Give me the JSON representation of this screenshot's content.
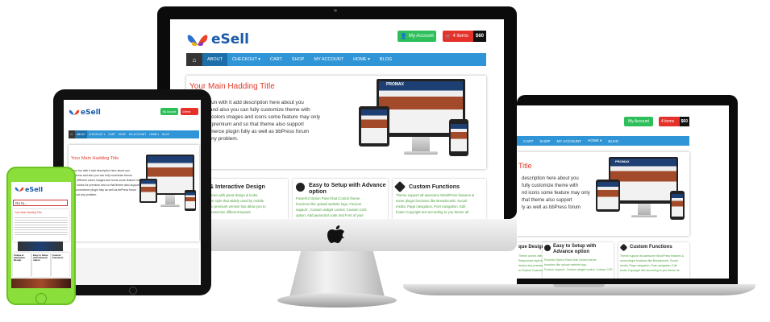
{
  "brand": {
    "logo_text": "eSell",
    "colors": {
      "blue": "#2f95d6",
      "green": "#2fbf5a",
      "red": "#e4322b",
      "title_red": "#e03a2a",
      "dark": "#353535"
    }
  },
  "header": {
    "account_label": "My Account",
    "cart_label": "4 items",
    "cart_price": "$60"
  },
  "nav": {
    "items": [
      "ABOUT",
      "CHECKOUT ▾",
      "CART",
      "SHOP",
      "MY ACCOUNT",
      "HOME ▾",
      "BLOG"
    ]
  },
  "hero": {
    "title": "Your Main Hadding Title",
    "lines_desktop": [
      "e fun with it add description here about you",
      "s and also you can fully customize theme with",
      "nt colors images and icons some feature may only",
      "or premium and so that theme also support",
      "mmerce plugin fully as well as bbPress forum",
      "t any problem."
    ],
    "lines_laptop": [
      "description here about you",
      "fully customize theme with",
      "nd icons some feature may only",
      "that theme also support",
      "ly as well as bbPress forum"
    ],
    "thumb_brand": "PROMAX"
  },
  "features": [
    {
      "title": "ique & Interactive Design",
      "lines": [
        "Theme comes with great design & looks.",
        "Responsive style that widely used by mobile",
        "device also premium version has allow you to",
        "Feature Customize different layouts"
      ]
    },
    {
      "title": "Easy to Setup with Advance option",
      "lines": [
        "Powerful Option Panel that Control theme",
        "functions like upload website logo, Favicon",
        "support , Custom widget control, Custom CSS",
        "option, Add javascript code and Font of your"
      ]
    },
    {
      "title": "Custom Functions",
      "lines": [
        "Theme support all awesome WordPress features &",
        "some plugin functions like Breadcrumb, Social",
        "media, Page navigation, Post navigation, Edit",
        "footer Copyright text according to you theme all"
      ]
    }
  ],
  "laptop": {
    "account_label": "My Account",
    "cart_label": "4 items",
    "cart_price": "$60",
    "nav_items": [
      "CART",
      "SHOP",
      "MY ACCOUNT",
      "HOME ▾",
      "BLOG"
    ],
    "hero_title": "Title",
    "features": [
      {
        "title": "que Design",
        "lines": [
          "Theme comes with great design & looks.",
          "Responsive style that widely used by mobile",
          "device also premium version has allow you",
          "to Feature Customize different layouts"
        ]
      },
      {
        "title": "Easy to Setup with Advance option",
        "lines": [
          "Powerful Option Panel that Control theme",
          "functions like upload website logo,",
          "Favicon support , Custom widget control, Custom CSS"
        ]
      },
      {
        "title": "Custom Functions",
        "lines": [
          "Theme support all awesome WordPress features &",
          "some plugin functions like Breadcrumb, Social",
          "media, Page navigation, Post navigation, Edit",
          "footer Copyright text according to you theme all"
        ]
      }
    ]
  },
  "tablet": {
    "logo_text": "eSell",
    "account_label": "My Account",
    "cart_label": "4 items",
    "nav_items": [
      "ABOUT",
      "CHECKOUT ▾",
      "CART",
      "SHOP",
      "MY ACCOUNT",
      "HOME ▾",
      "BLOG"
    ],
    "hero_title": "Your Main Hadding Title",
    "hero_lines": [
      "Have fun with it add description here about you",
      "business and also you can fully customize theme",
      "with different colors images and icons some feature may",
      "only works for premium and so that theme also support",
      "Woocommerce plugin fully as well as bbPress forum",
      "without any problem."
    ]
  },
  "phone": {
    "logo_text": "eSell",
    "menu_label": "Go to...",
    "hero_title": "Your Main Hadding Title",
    "features": [
      "Unique & Interactive Design",
      "Easy to Setup with Advance option",
      "Custom Functions"
    ]
  }
}
